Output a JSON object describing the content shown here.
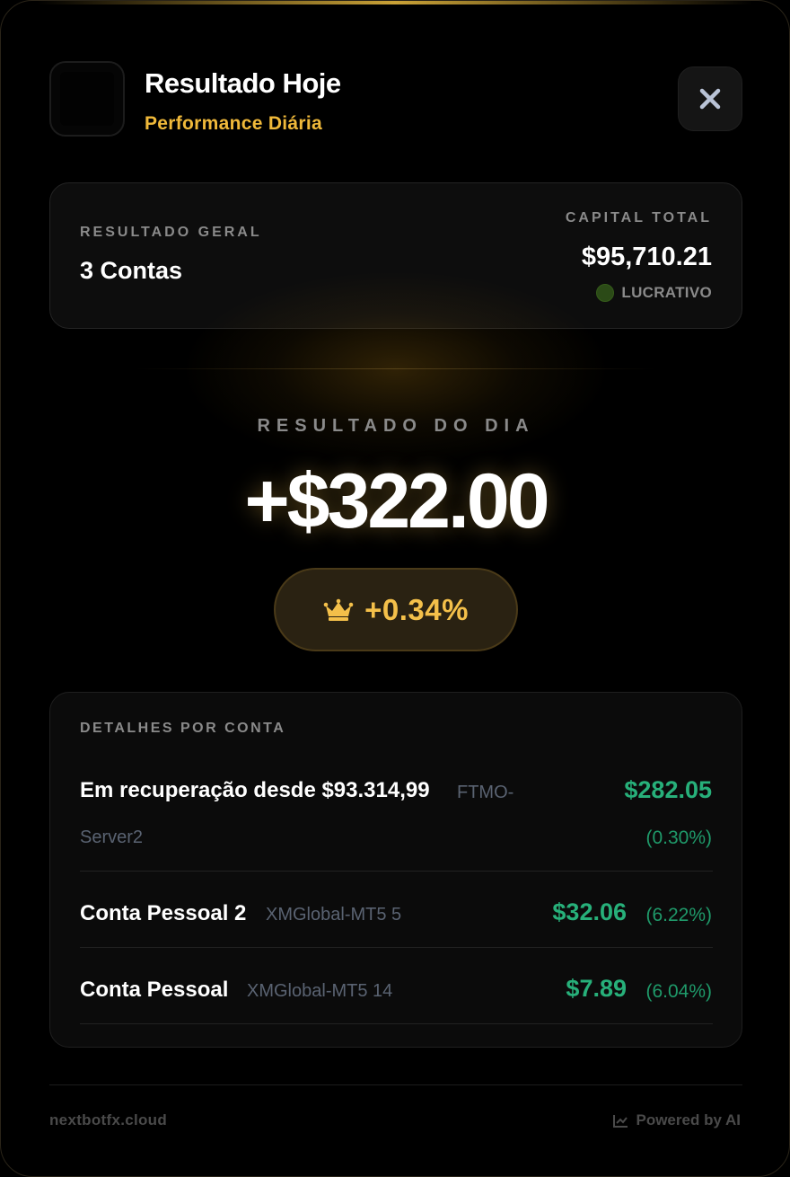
{
  "header": {
    "title": "Resultado Hoje",
    "subtitle": "Performance Diária"
  },
  "summary": {
    "left_label": "RESULTADO GERAL",
    "left_value": "3 Contas",
    "right_label": "CAPITAL TOTAL",
    "right_value": "$95,710.21",
    "status": "LUCRATIVO"
  },
  "day": {
    "label": "RESULTADO DO DIA",
    "value": "+$322.00",
    "percent": "+0.34%"
  },
  "details": {
    "label": "DETALHES POR CONTA",
    "accounts": [
      {
        "name": "Em recuperação desde $93.314,99",
        "server_line1": "FTMO-",
        "server_line2": "Server2",
        "amount": "$282.05",
        "percent": "(0.30%)"
      },
      {
        "name": "Conta Pessoal 2",
        "server": "XMGlobal-MT5 5",
        "amount": "$32.06",
        "percent": "(6.22%)"
      },
      {
        "name": "Conta Pessoal",
        "server": "XMGlobal-MT5 14",
        "amount": "$7.89",
        "percent": "(6.04%)"
      }
    ]
  },
  "footer": {
    "domain": "nextbotfx.cloud",
    "powered": "Powered by AI"
  },
  "colors": {
    "accent_gold": "#f0b93a",
    "profit_green": "#27b07a",
    "background": "#000000"
  },
  "icons": {
    "close": "close-icon",
    "crown": "crown-icon",
    "status": "status-dot-icon",
    "chart": "chart-icon"
  }
}
